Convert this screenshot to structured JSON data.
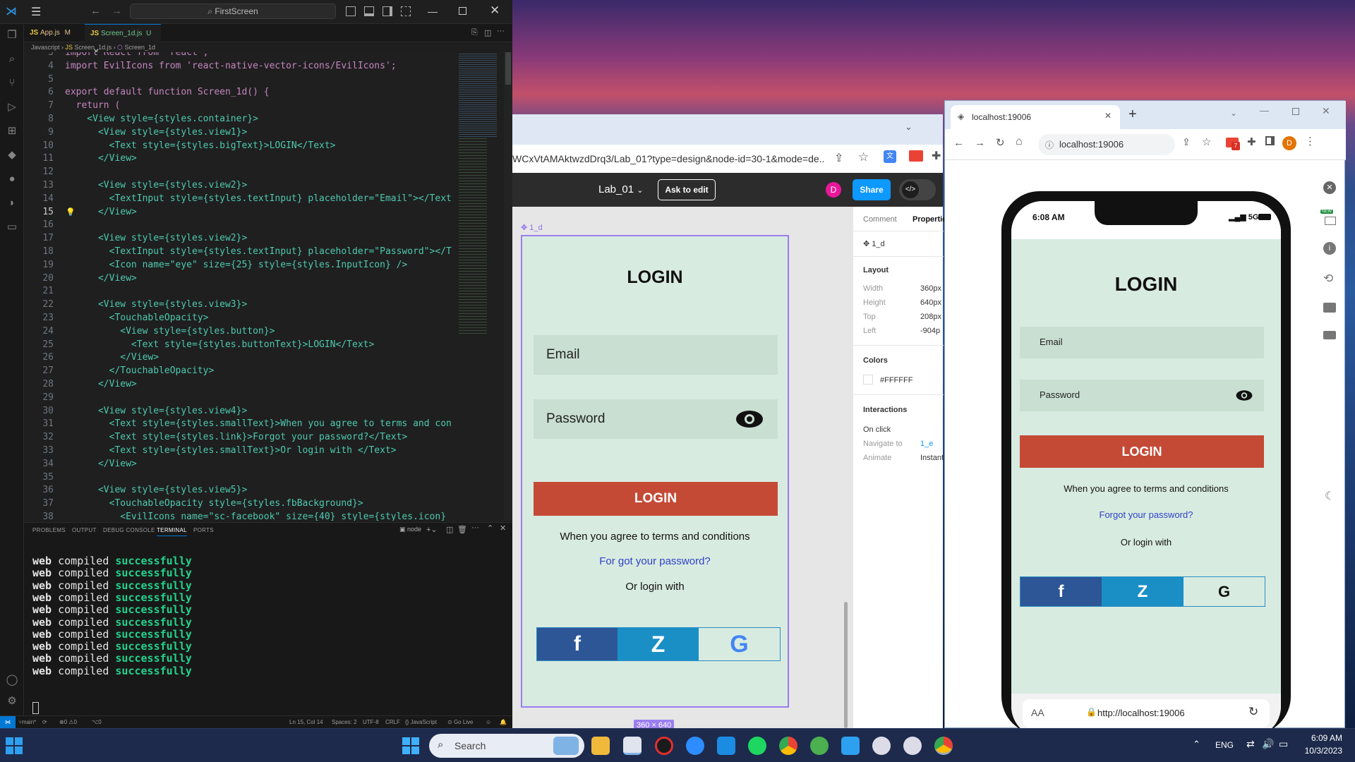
{
  "vscode": {
    "search": "FirstScreen",
    "tabs": [
      {
        "label": "App.js",
        "badge": "M"
      },
      {
        "label": "Screen_1d.js",
        "badge": "U"
      }
    ],
    "breadcrumb": [
      "Javascript",
      "Screen_1d.js",
      "Screen_1d"
    ],
    "code": [
      {
        "n": "3",
        "t": "import React from 'react';"
      },
      {
        "n": "4",
        "t": "import EvilIcons from 'react-native-vector-icons/EvilIcons';"
      },
      {
        "n": "5",
        "t": ""
      },
      {
        "n": "6",
        "t": "export default function Screen_1d() {"
      },
      {
        "n": "7",
        "t": "  return ("
      },
      {
        "n": "8",
        "t": "    <View style={styles.container}>"
      },
      {
        "n": "9",
        "t": "      <View style={styles.view1}>"
      },
      {
        "n": "10",
        "t": "        <Text style={styles.bigText}>LOGIN</Text>"
      },
      {
        "n": "11",
        "t": "      </View>"
      },
      {
        "n": "12",
        "t": ""
      },
      {
        "n": "13",
        "t": "      <View style={styles.view2}>"
      },
      {
        "n": "14",
        "t": "        <TextInput style={styles.textInput} placeholder=\"Email\"></TextIn"
      },
      {
        "n": "15",
        "t": "      </View>"
      },
      {
        "n": "16",
        "t": ""
      },
      {
        "n": "17",
        "t": "      <View style={styles.view2}>"
      },
      {
        "n": "18",
        "t": "        <TextInput style={styles.textInput} placeholder=\"Password\"></Te"
      },
      {
        "n": "19",
        "t": "        <Icon name=\"eye\" size={25} style={styles.InputIcon} />"
      },
      {
        "n": "20",
        "t": "      </View>"
      },
      {
        "n": "21",
        "t": ""
      },
      {
        "n": "22",
        "t": "      <View style={styles.view3}>"
      },
      {
        "n": "23",
        "t": "        <TouchableOpacity>"
      },
      {
        "n": "24",
        "t": "          <View style={styles.button}>"
      },
      {
        "n": "25",
        "t": "            <Text style={styles.buttonText}>LOGIN</Text>"
      },
      {
        "n": "26",
        "t": "          </View>"
      },
      {
        "n": "27",
        "t": "        </TouchableOpacity>"
      },
      {
        "n": "28",
        "t": "      </View>"
      },
      {
        "n": "29",
        "t": ""
      },
      {
        "n": "30",
        "t": "      <View style={styles.view4}>"
      },
      {
        "n": "31",
        "t": "        <Text style={styles.smallText}>When you agree to terms and condi"
      },
      {
        "n": "32",
        "t": "        <Text style={styles.link}>Forgot your password?</Text>"
      },
      {
        "n": "33",
        "t": "        <Text style={styles.smallText}>Or login with </Text>"
      },
      {
        "n": "34",
        "t": "      </View>"
      },
      {
        "n": "35",
        "t": ""
      },
      {
        "n": "36",
        "t": "      <View style={styles.view5}>"
      },
      {
        "n": "37",
        "t": "        <TouchableOpacity style={styles.fbBackground}>"
      },
      {
        "n": "38",
        "t": "          <EvilIcons name=\"sc-facebook\" size={40} style={styles.icon} />"
      }
    ],
    "panel_tabs": [
      "PROBLEMS",
      "OUTPUT",
      "DEBUG CONSOLE",
      "TERMINAL",
      "PORTS"
    ],
    "terminal_node": "node",
    "terminal": {
      "word1": "web",
      "word2": "compiled",
      "word3": "successfully",
      "repeat": 10
    },
    "status": {
      "branch": "main*",
      "errors": "0",
      "warnings": "0",
      "ports": "0",
      "position": "Ln 15, Col 14",
      "spaces": "Spaces: 2",
      "encoding": "UTF-8",
      "eol": "CRLF",
      "language": "JavaScript",
      "golive": "Go Live"
    }
  },
  "figma": {
    "url": "WCxVtAMAktwzdDrq3/Lab_01?type=design&node-id=30-1&mode=de...",
    "file_name": "Lab_01",
    "ask_edit": "Ask to edit",
    "avatar": "D",
    "share": "Share",
    "frame_label": "1_d",
    "frame_size": "360 × 640",
    "props_tabs": [
      "Comment",
      "Propertie"
    ],
    "layer": "1_d",
    "layout_title": "Layout",
    "layout": [
      {
        "k": "Width",
        "v": "360px"
      },
      {
        "k": "Height",
        "v": "640px"
      },
      {
        "k": "Top",
        "v": "208px"
      },
      {
        "k": "Left",
        "v": "-904p"
      }
    ],
    "colors_title": "Colors",
    "color_hex": "#FFFFFF",
    "interactions_title": "Interactions",
    "on_click": "On click",
    "navigate_k": "Navigate to",
    "navigate_v": "1_e",
    "animate_k": "Animate",
    "animate_v": "Instant"
  },
  "mockup": {
    "title": "LOGIN",
    "email": "Email",
    "password": "Password",
    "button": "LOGIN",
    "terms": "When you agree to terms and conditions",
    "forgot_figma": "For got your password?",
    "forgot_app": "Forgot your password?",
    "or_login": "Or login with",
    "social": [
      "f",
      "Z",
      "G"
    ]
  },
  "chrome": {
    "tab_title": "localhost:19006",
    "address": "localhost:19006",
    "avatar": "D",
    "gmail_badge": "7",
    "phone_time": "6:08 AM",
    "phone_signal": "5G",
    "phone_url": "http://localhost:19006",
    "aa": "AA",
    "side_new": "NEW"
  },
  "taskbar": {
    "search": "Search",
    "lang": "ENG",
    "time": "6:09 AM",
    "date": "10/3/2023"
  },
  "colors": {
    "mock_bg": "#d8ebe0",
    "login_red": "#c44a36",
    "fb_blue": "#2d5697",
    "zoom_blue": "#1a8fc6",
    "link_blue": "#2f41c8",
    "term_green": "#23d18b",
    "figma_share": "#0d99ff"
  }
}
